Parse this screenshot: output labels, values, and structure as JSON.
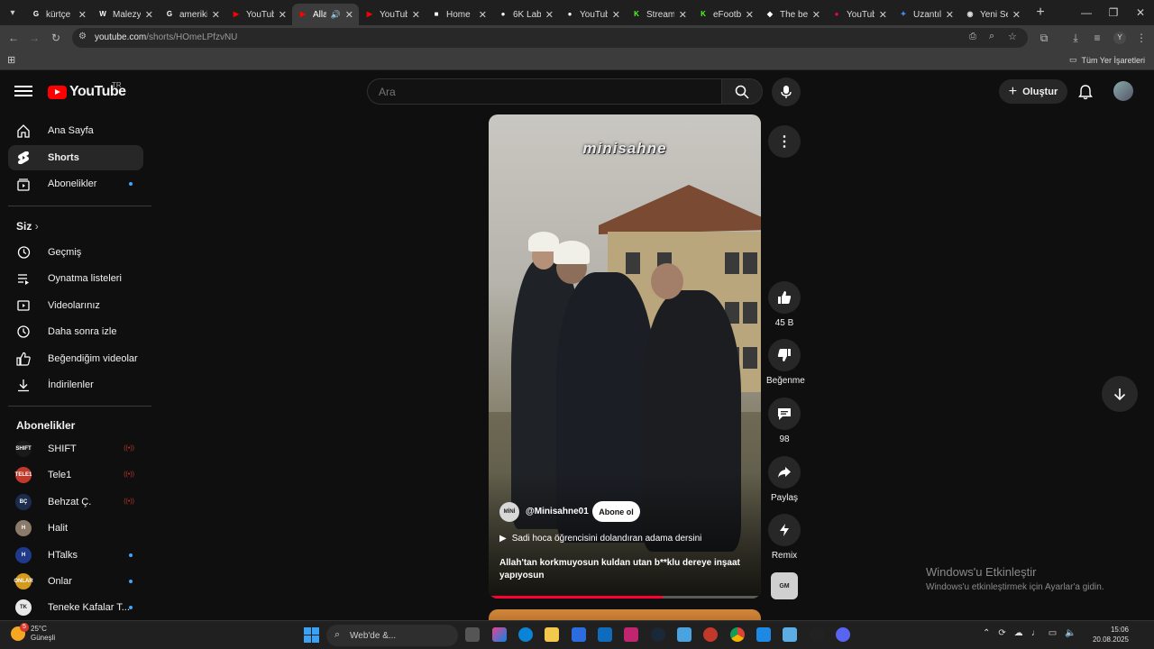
{
  "browser": {
    "tabs": [
      {
        "title": "kürtçe",
        "favicon": "G",
        "color": "#ffffff"
      },
      {
        "title": "Malezy",
        "favicon": "W",
        "color": "#ffffff"
      },
      {
        "title": "ameriki",
        "favicon": "G",
        "color": "#ffffff"
      },
      {
        "title": "YouTub",
        "favicon": "▶",
        "color": "#ff0000"
      },
      {
        "title": "Alla",
        "favicon": "▶",
        "color": "#ff0000",
        "active": true,
        "audio": "🔊"
      },
      {
        "title": "YouTub",
        "favicon": "▶",
        "color": "#ff0000"
      },
      {
        "title": "Home",
        "favicon": "■",
        "color": "#ffffff"
      },
      {
        "title": "6K Labs",
        "favicon": "●",
        "color": "#ffffff"
      },
      {
        "title": "YouTub",
        "favicon": "●",
        "color": "#ffffff"
      },
      {
        "title": "Stream",
        "favicon": "K",
        "color": "#53fc18"
      },
      {
        "title": "eFootb",
        "favicon": "K",
        "color": "#53fc18"
      },
      {
        "title": "The be",
        "favicon": "◆",
        "color": "#ffffff"
      },
      {
        "title": "YouTub",
        "favicon": "●",
        "color": "#ff0033"
      },
      {
        "title": "Uzantıl",
        "favicon": "✦",
        "color": "#4c8bf5"
      },
      {
        "title": "Yeni Se",
        "favicon": "◉",
        "color": "#dddddd"
      }
    ],
    "url_host": "youtube.com",
    "url_path": "/shorts/HOmeLPfzvNU",
    "bookmarks_all": "Tüm Yer İşaretleri"
  },
  "header": {
    "logo_text": "YouTube",
    "country": "TR",
    "search_placeholder": "Ara",
    "create_label": "Oluştur"
  },
  "sidebar": {
    "main": [
      {
        "label": "Ana Sayfa",
        "icon": "home-icon"
      },
      {
        "label": "Shorts",
        "icon": "shorts-icon",
        "active": true
      },
      {
        "label": "Abonelikler",
        "icon": "subscriptions-icon",
        "dot": true
      }
    ],
    "you_heading": "Siz",
    "you": [
      {
        "label": "Geçmiş",
        "icon": "history-icon"
      },
      {
        "label": "Oynatma listeleri",
        "icon": "playlists-icon"
      },
      {
        "label": "Videolarınız",
        "icon": "your-videos-icon"
      },
      {
        "label": "Daha sonra izle",
        "icon": "watch-later-icon"
      },
      {
        "label": "Beğendiğim videolar",
        "icon": "liked-icon"
      },
      {
        "label": "İndirilenler",
        "icon": "downloads-icon"
      }
    ],
    "subs_heading": "Abonelikler",
    "subscriptions": [
      {
        "label": "SHIFT",
        "avatar": "SHIFT",
        "bg": "#1a1a1a",
        "status": "live",
        "live_text": "((•))"
      },
      {
        "label": "Tele1",
        "avatar": "TELE1",
        "bg": "#c0392b",
        "status": "live",
        "live_text": "((•))"
      },
      {
        "label": "Behzat Ç.",
        "avatar": "BÇ",
        "bg": "#1c2c4c",
        "status": "live",
        "live_text": "((•))"
      },
      {
        "label": "Halit",
        "avatar": "H",
        "bg": "#8a7a6a",
        "status": ""
      },
      {
        "label": "HTalks",
        "avatar": "H",
        "bg": "#1f3a8a",
        "status": "dot"
      },
      {
        "label": "Onlar",
        "avatar": "ONLAR",
        "bg": "#d49a1e",
        "status": "dot"
      },
      {
        "label": "Teneke Kafalar T...",
        "avatar": "TK",
        "bg": "#e8e8e8",
        "status": "dot"
      }
    ]
  },
  "short": {
    "watermark": "minisahne",
    "channel_avatar": "MİNİ",
    "channel": "@Minisahne01",
    "subscribe_label": "Abone ol",
    "song_title": "Sadi hoca öğrencisini dolandıran adama dersini",
    "caption": "Allah'tan korkmuyosun kuldan utan b**klu dereye inşaat yapıyosun",
    "progress": 0.64
  },
  "actions": {
    "like_count": "45 B",
    "dislike_label": "Beğenme",
    "comment_count": "98",
    "share_label": "Paylaş",
    "remix_label": "Remix",
    "sound_thumb": "GM"
  },
  "windows_activation": {
    "title": "Windows'u Etkinleştir",
    "subtitle": "Windows'u etkinleştirmek için Ayarlar'a gidin."
  },
  "taskbar": {
    "temp": "25°C",
    "weather": "Güneşli",
    "weather_badge": "5",
    "search_placeholder": "Web'de &...",
    "time": "15:06",
    "date": "20.08.2025"
  }
}
